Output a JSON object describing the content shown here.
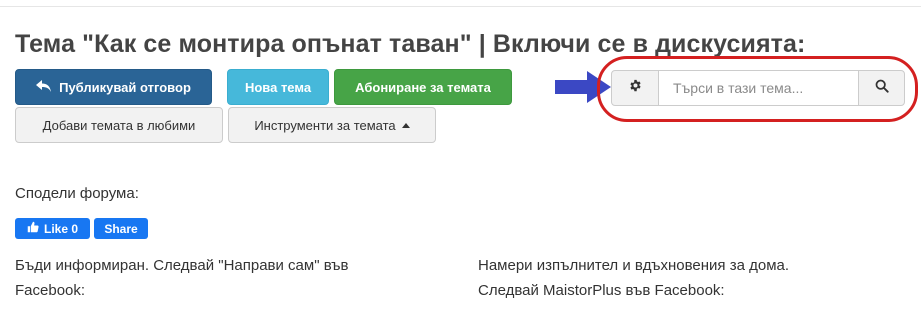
{
  "page": {
    "title": "Тема \"Как се монтира опънат таван\" | Включи се в дискусията:"
  },
  "toolbar": {
    "reply_label": "Публикувай отговор",
    "new_topic_label": "Нова тема",
    "subscribe_label": "Абониране за темата",
    "favorite_label": "Добави темата в любими",
    "tools_label": "Инструменти за темата"
  },
  "search": {
    "placeholder": "Търси в тази тема..."
  },
  "share": {
    "label": "Сподели форума:",
    "like_label": "Like 0",
    "share_label": "Share"
  },
  "follow": {
    "left_line1": "Бъди информиран. Следвай \"Направи сам\" във",
    "left_line2": "Facebook:",
    "right_line1": "Намери изпълнител и вдъхновения за дома.",
    "right_line2": "Следвай MaistorPlus във Facebook:"
  },
  "icons": {
    "reply": "reply-icon",
    "caret": "caret-up-icon",
    "gear": "gear-icon",
    "search": "search-icon",
    "thumb": "thumbs-up-icon",
    "arrow": "arrow-right-annotation"
  },
  "colors": {
    "primary": "#2a6496",
    "info": "#46b8da",
    "success": "#47a447",
    "facebook": "#1877f2",
    "annotation_red": "#d42020",
    "annotation_blue": "#3b48c4"
  }
}
